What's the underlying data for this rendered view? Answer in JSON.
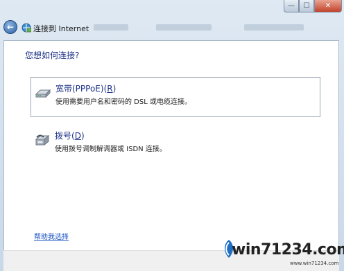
{
  "window": {
    "min_glyph": "—",
    "max_glyph": "☐",
    "close_glyph": "✕"
  },
  "nav": {
    "title": "连接到 Internet"
  },
  "main": {
    "heading": "您想如何连接?",
    "options": [
      {
        "title_prefix": "宽带(PPPoE)(",
        "accel": "R",
        "title_suffix": ")",
        "description": "使用需要用户名和密码的 DSL 或电缆连接。",
        "icon": "broadband-modem-icon",
        "selected": true
      },
      {
        "title_prefix": "拨号(",
        "accel": "D",
        "title_suffix": ")",
        "description": "使用拨号调制解调器或 ISDN 连接。",
        "icon": "dialup-phone-icon",
        "selected": false
      }
    ],
    "help_link": "帮助我选择"
  },
  "watermark": {
    "text": "win71234.com",
    "sub": "www.win71234.com"
  },
  "colors": {
    "heading": "#1e3287",
    "link": "#1b52c4",
    "close": "#c2432a"
  }
}
